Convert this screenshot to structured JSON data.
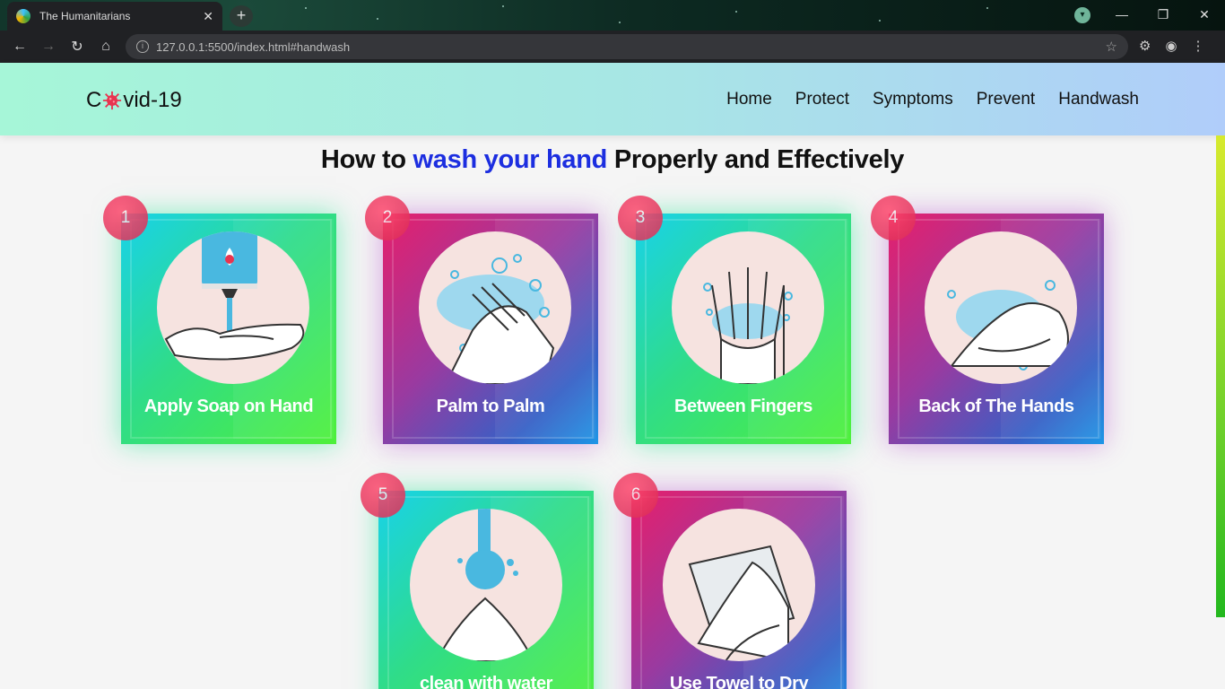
{
  "browser": {
    "tab_title": "The Humanitarians",
    "close_glyph": "✕",
    "new_tab_glyph": "+",
    "url": "127.0.0.1:5500/index.html#handwash",
    "profile_initial": "▾"
  },
  "site": {
    "logo_prefix": "C",
    "logo_suffix": "vid-19",
    "nav": [
      "Home",
      "Protect",
      "Symptoms",
      "Prevent",
      "Handwash"
    ]
  },
  "heading": {
    "before": "How to ",
    "accent": "wash your hand",
    "after": " Properly and Effectively"
  },
  "steps": [
    {
      "number": "1",
      "label": "Apply Soap on Hand",
      "theme": "green",
      "icon": "soap-dispenser-icon"
    },
    {
      "number": "2",
      "label": "Palm to Palm",
      "theme": "purple",
      "icon": "palm-to-palm-icon"
    },
    {
      "number": "3",
      "label": "Between Fingers",
      "theme": "green",
      "icon": "between-fingers-icon"
    },
    {
      "number": "4",
      "label": "Back of The Hands",
      "theme": "purple",
      "icon": "back-of-hands-icon"
    },
    {
      "number": "5",
      "label": "clean with water",
      "theme": "green",
      "icon": "rinse-water-icon"
    },
    {
      "number": "6",
      "label": "Use Towel to Dry",
      "theme": "purple",
      "icon": "towel-dry-icon"
    }
  ],
  "colors": {
    "accent_blue": "#1c2ee0",
    "badge_red": "#e8345c",
    "card_green": "#2fdc8a",
    "card_purple": "#9a3aa0"
  }
}
